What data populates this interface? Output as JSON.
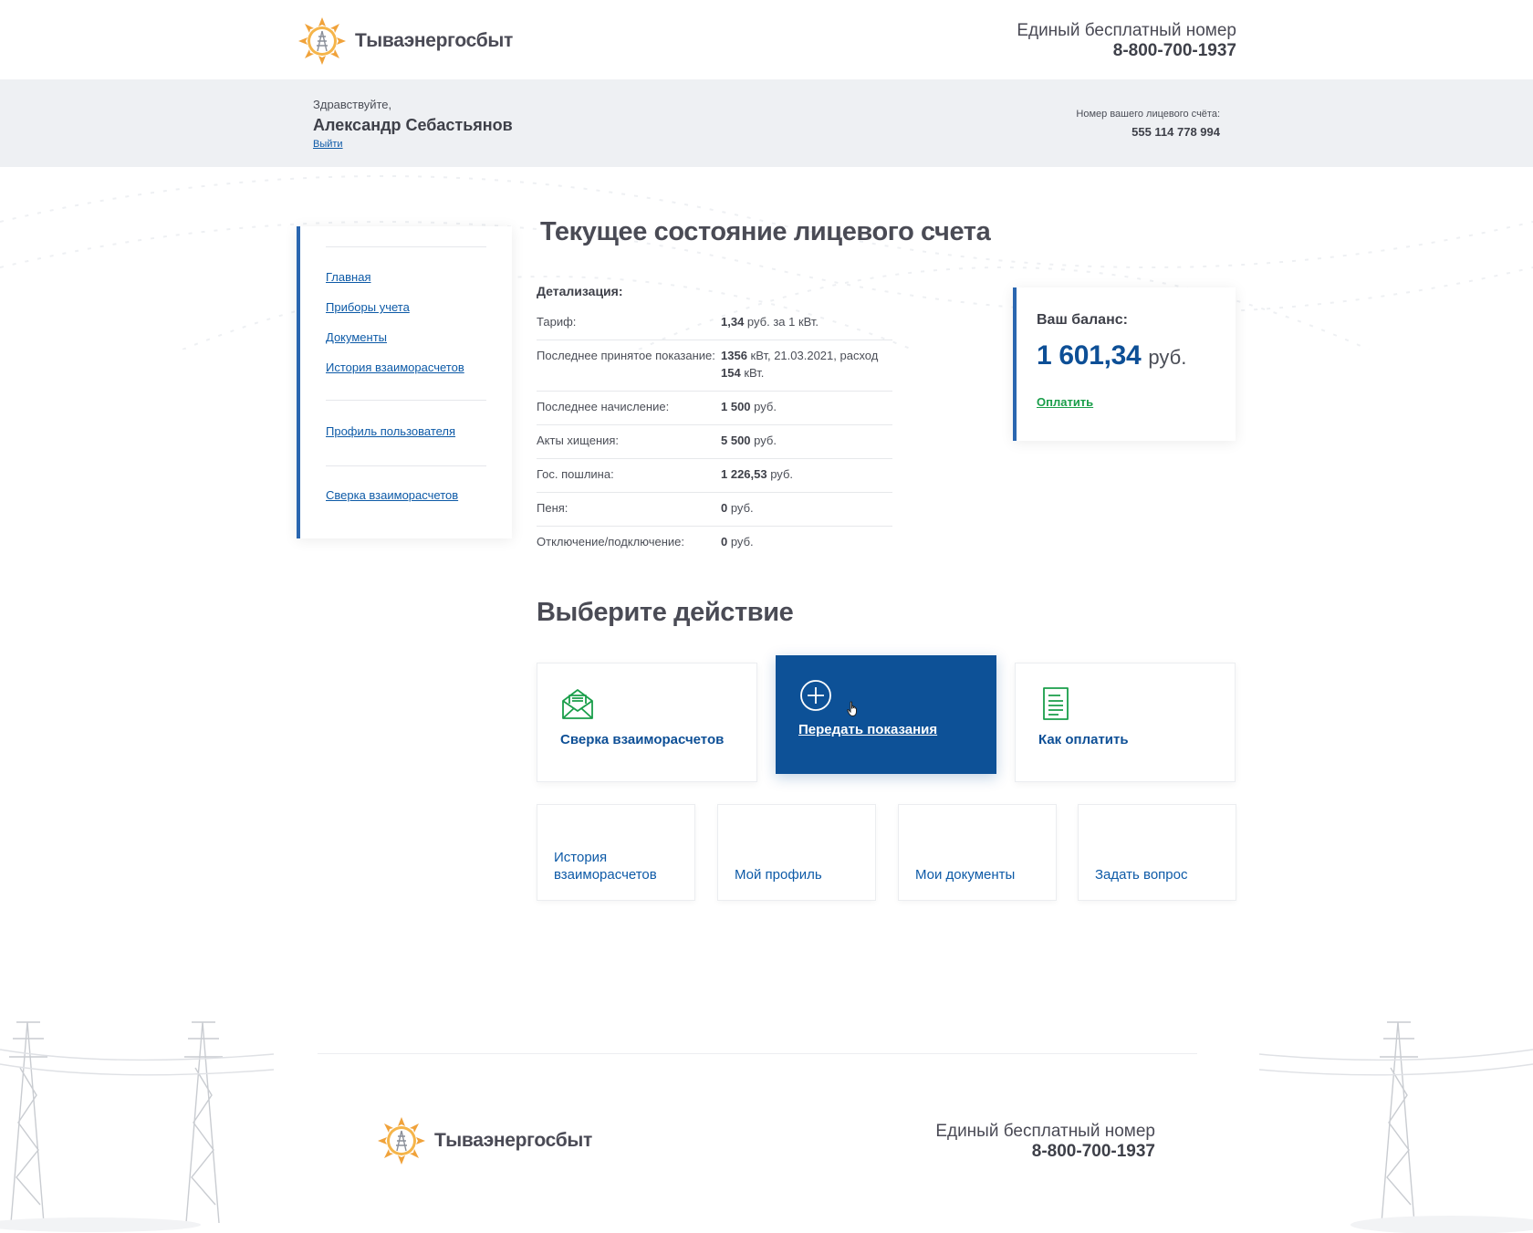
{
  "brand": {
    "name": "Тываэнергосбыт",
    "accent": "#0d5197",
    "logo_sun": "#f0a23a"
  },
  "header": {
    "phone_label": "Единый бесплатный номер",
    "phone_number": "8-800-700-1937"
  },
  "user": {
    "greeting": "Здравствуйте,",
    "name": "Александр Себастьянов",
    "logout": "Выйти",
    "account_label": "Номер вашего лицевого счёта:",
    "account_number": "555 114 778 994"
  },
  "sidebar": {
    "items": [
      {
        "label": "Главная"
      },
      {
        "label": "Приборы учета"
      },
      {
        "label": "Документы"
      },
      {
        "label": "История взаиморасчетов"
      },
      {
        "label": "Профиль пользователя"
      },
      {
        "label": "Сверка взаиморасчетов"
      }
    ]
  },
  "main": {
    "title": "Текущее состояние лицевого счета",
    "details_title": "Детализация:",
    "details": [
      {
        "label": "Тариф:",
        "bold": "1,34",
        "rest": " руб. за 1 кВт."
      },
      {
        "label": "Последнее принятое показание:",
        "bold": "1356",
        "rest": " кВт, 21.03.2021, расход ",
        "bold2": "154",
        "rest2": " кВт."
      },
      {
        "label": "Последнее начисление:",
        "bold": "1 500",
        "rest": " руб."
      },
      {
        "label": "Акты хищения:",
        "bold": "5 500",
        "rest": " руб."
      },
      {
        "label": "Гос. пошлина:",
        "bold": "1 226,53",
        "rest": " руб."
      },
      {
        "label": "Пеня:",
        "bold": "0",
        "rest": " руб."
      },
      {
        "label": "Отключение/подключение:",
        "bold": "0",
        "rest": " руб."
      }
    ]
  },
  "balance": {
    "label": "Ваш баланс:",
    "amount": "1 601,34",
    "currency": "руб.",
    "pay": "Оплатить"
  },
  "actions": {
    "title": "Выберите действие",
    "primary": [
      {
        "label": "Сверка взаиморасчетов",
        "icon": "envelope-icon"
      },
      {
        "label": "Передать показания",
        "icon": "plus-circle-icon"
      },
      {
        "label": "Как оплатить",
        "icon": "document-icon"
      }
    ],
    "secondary": [
      {
        "label": "История взаиморасчетов"
      },
      {
        "label": "Мой профиль"
      },
      {
        "label": "Мои документы"
      },
      {
        "label": "Задать вопрос"
      }
    ]
  },
  "footer": {
    "phone_label": "Единый бесплатный номер",
    "phone_number": "8-800-700-1937"
  }
}
